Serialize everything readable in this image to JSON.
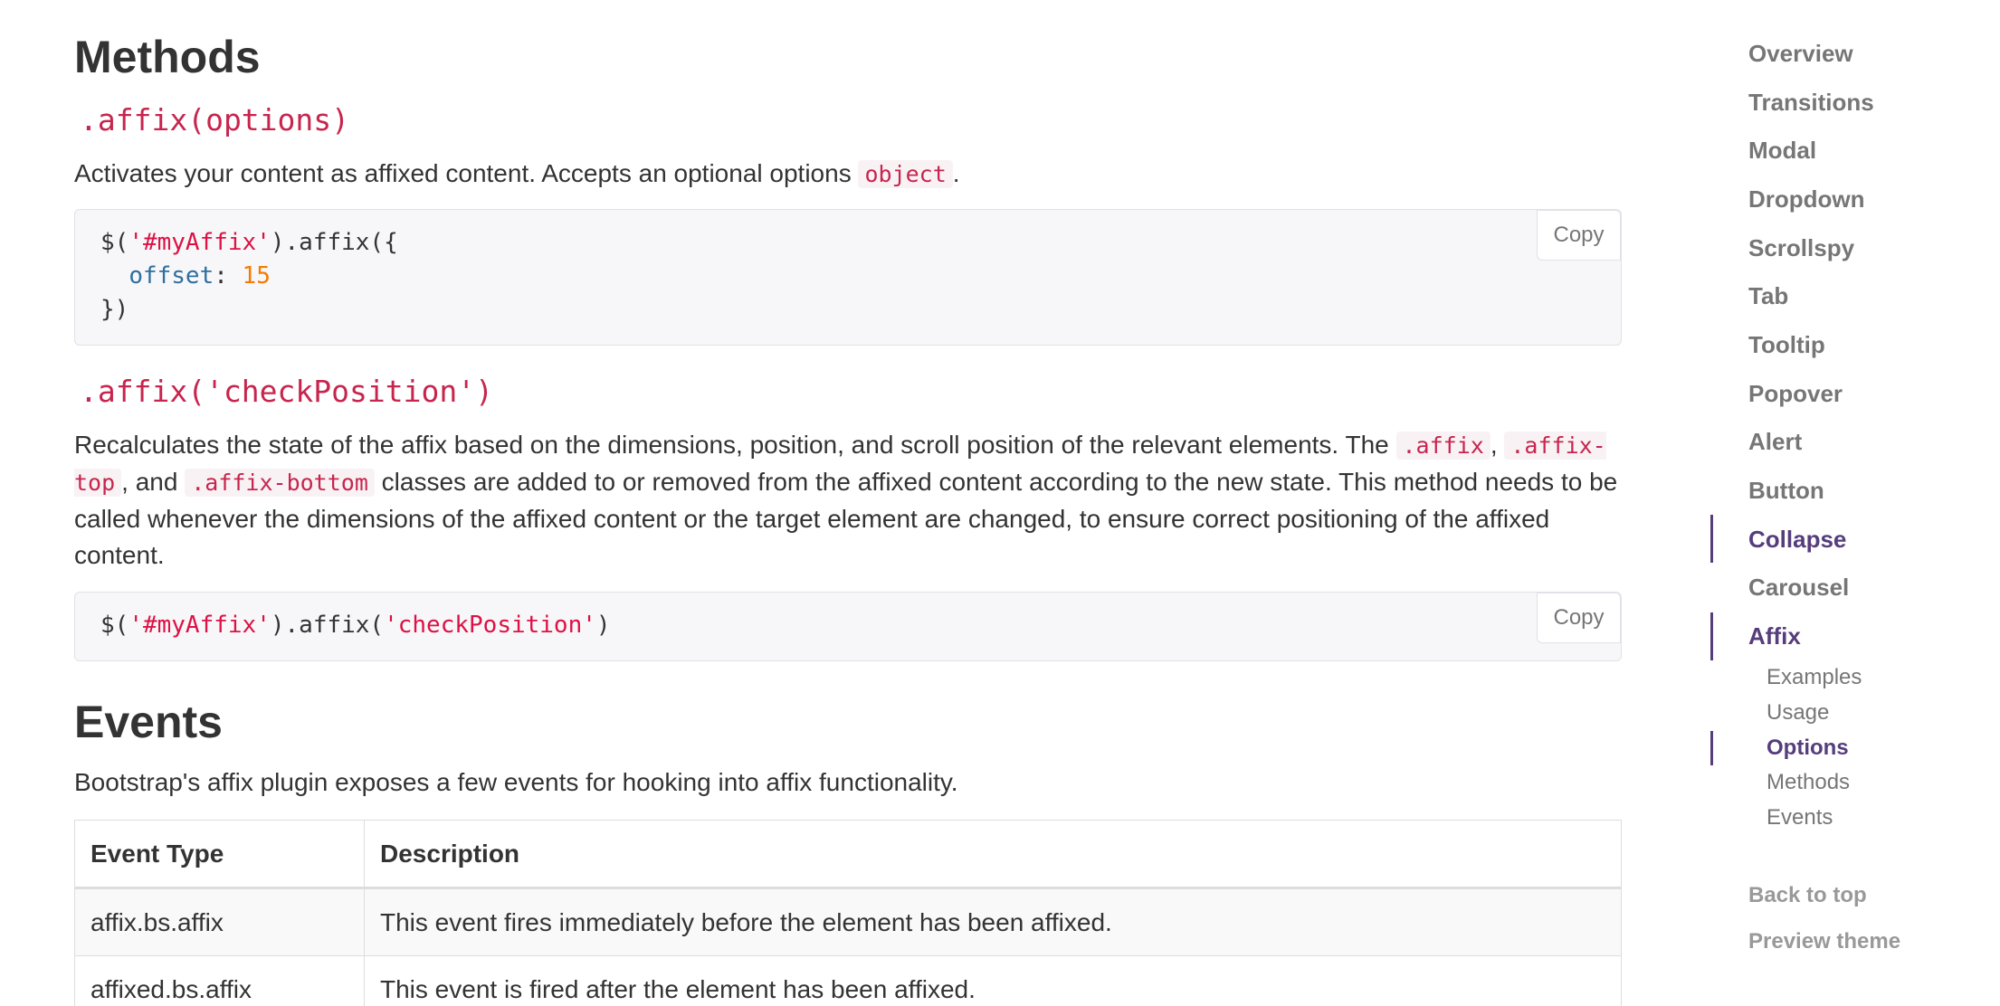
{
  "methods": {
    "heading": "Methods",
    "affix_options": {
      "signature": ".affix(options)",
      "desc_before": "Activates your content as affixed content. Accepts an optional options ",
      "desc_code": "object",
      "desc_after": ".",
      "code": {
        "line1_a": "$(",
        "line1_str": "'#myAffix'",
        "line1_b": ").affix({",
        "line2_key": "offset",
        "line2_colon": ": ",
        "line2_num": "15",
        "line3": "})"
      },
      "copy_label": "Copy"
    },
    "check_position": {
      "signature": ".affix('checkPosition')",
      "desc_1": "Recalculates the state of the affix based on the dimensions, position, and scroll position of the relevant elements. The ",
      "code_1": ".affix",
      "sep_1": ", ",
      "code_2": ".affix-top",
      "sep_2": ", and ",
      "code_3": ".affix-bottom",
      "desc_2": " classes are added to or removed from the affixed content according to the new state. This method needs to be called whenever the dimensions of the affixed content or the target element are changed, to ensure correct positioning of the affixed content.",
      "code": {
        "a": "$(",
        "str1": "'#myAffix'",
        "b": ").affix(",
        "str2": "'checkPosition'",
        "c": ")"
      },
      "copy_label": "Copy"
    }
  },
  "events": {
    "heading": "Events",
    "intro": "Bootstrap's affix plugin exposes a few events for hooking into affix functionality.",
    "columns": [
      "Event Type",
      "Description"
    ],
    "rows": [
      [
        "affix.bs.affix",
        "This event fires immediately before the element has been affixed."
      ],
      [
        "affixed.bs.affix",
        "This event is fired after the element has been affixed."
      ]
    ]
  },
  "sidenav": {
    "items": [
      "Overview",
      "Transitions",
      "Modal",
      "Dropdown",
      "Scrollspy",
      "Tab",
      "Tooltip",
      "Popover",
      "Alert",
      "Button",
      "Collapse",
      "Carousel",
      "Affix"
    ],
    "active_item": "Affix",
    "highlighted_item": "Collapse",
    "sub_items": [
      "Examples",
      "Usage",
      "Options",
      "Methods",
      "Events"
    ],
    "active_sub_item": "Options",
    "footer": [
      "Back to top",
      "Preview theme"
    ]
  },
  "colors": {
    "accent": "#563d7c",
    "code_pink": "#c7254e",
    "text": "#333333",
    "muted": "#767676"
  }
}
